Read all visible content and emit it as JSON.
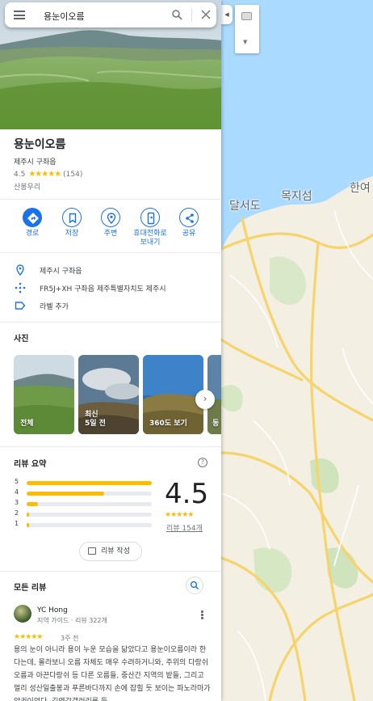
{
  "search": {
    "query": "용눈이오름"
  },
  "place": {
    "title": "용눈이오름",
    "subtitle": "제주시 구좌읍",
    "rating": "4.5",
    "review_count_paren": "(154)",
    "category": "산봉우리"
  },
  "actions": [
    {
      "label": "경로",
      "icon": "directions-icon"
    },
    {
      "label": "저장",
      "icon": "bookmark-icon"
    },
    {
      "label": "주변",
      "icon": "nearby-icon"
    },
    {
      "label": "휴대전화로\n보내기",
      "icon": "send-to-phone-icon"
    },
    {
      "label": "공유",
      "icon": "share-icon"
    }
  ],
  "info": {
    "address": "제주시 구좌읍",
    "plus_code": "FR5J+XH 구좌읍 제주특별자치도 제주시",
    "add_label": "라벨 추가"
  },
  "photos": {
    "heading": "사진",
    "items": [
      {
        "label": "전체"
      },
      {
        "label": "최신\n5일 전"
      },
      {
        "label": "360도 보기"
      },
      {
        "label": "동"
      }
    ]
  },
  "reviews_summary": {
    "heading": "리뷰 요약",
    "bars": [
      {
        "star": "5",
        "fraction": 1.0
      },
      {
        "star": "4",
        "fraction": 0.62
      },
      {
        "star": "3",
        "fraction": 0.09
      },
      {
        "star": "2",
        "fraction": 0.02
      },
      {
        "star": "1",
        "fraction": 0.02
      }
    ],
    "rating": "4.5",
    "stars": "★★★★★",
    "review_count": "리뷰 154개",
    "write_review": "리뷰 작성"
  },
  "all_reviews": {
    "heading": "모든 리뷰",
    "review": {
      "author": "YC Hong",
      "meta": "지역 가이드 · 리뷰 322개",
      "stars": "★★★★★",
      "date": "3주 전",
      "text": "용의 눈이 아니라 용이 누운 모습을 닮았다고 용눈이오름이라 한다는데, 몰라보니 오름 자체도 매우 수려하거니와, 주위의 다랑쉬오름과 아끈다랑쉬 등 다른 오름들, 중산간 지역의 밭들, 그리고 멀리 성산일출봉과 푸른바다까지 손에 잡힐 듯 보이는 파노라마가 압권이었다. 김영갑갤러리를 들"
    }
  },
  "map": {
    "labels": [
      "달서도",
      "목지섬",
      "한여"
    ]
  },
  "colors": {
    "accent": "#1a73e8",
    "star": "#fbbc04"
  }
}
